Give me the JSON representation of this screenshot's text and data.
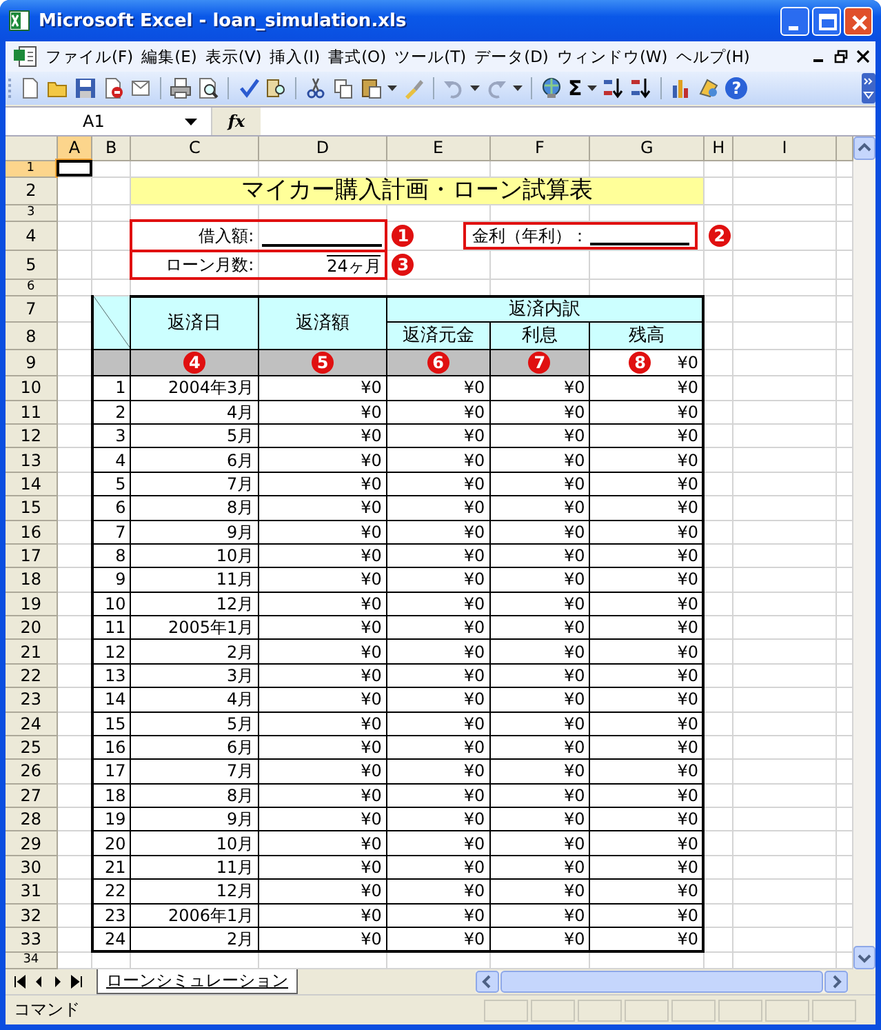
{
  "window": {
    "title": "Microsoft Excel - loan_simulation.xls"
  },
  "menu": [
    {
      "label": "ファイル(F)"
    },
    {
      "label": "編集(E)"
    },
    {
      "label": "表示(V)"
    },
    {
      "label": "挿入(I)"
    },
    {
      "label": "書式(O)"
    },
    {
      "label": "ツール(T)"
    },
    {
      "label": "データ(D)"
    },
    {
      "label": "ウィンドウ(W)"
    },
    {
      "label": "ヘルプ(H)"
    }
  ],
  "toolbar": {
    "autosum": "Σ",
    "help": "?"
  },
  "formula_bar": {
    "name_box": "A1",
    "fx_label": "fx"
  },
  "columns": [
    {
      "label": "A",
      "selected": true
    },
    {
      "label": "B",
      "selected": false
    },
    {
      "label": "C",
      "selected": false
    },
    {
      "label": "D",
      "selected": false
    },
    {
      "label": "E",
      "selected": false
    },
    {
      "label": "F",
      "selected": false
    },
    {
      "label": "G",
      "selected": false
    },
    {
      "label": "H",
      "selected": false
    },
    {
      "label": "I",
      "selected": false
    }
  ],
  "row_headers": [
    {
      "label": "1",
      "selected": true
    },
    {
      "label": "2",
      "selected": false
    },
    {
      "label": "3",
      "selected": false
    },
    {
      "label": "4",
      "selected": false
    },
    {
      "label": "5",
      "selected": false
    },
    {
      "label": "6",
      "selected": false
    },
    {
      "label": "7",
      "selected": false
    },
    {
      "label": "8",
      "selected": false
    },
    {
      "label": "9",
      "selected": false
    },
    {
      "label": "10",
      "selected": false
    },
    {
      "label": "11",
      "selected": false
    },
    {
      "label": "12",
      "selected": false
    },
    {
      "label": "13",
      "selected": false
    },
    {
      "label": "14",
      "selected": false
    },
    {
      "label": "15",
      "selected": false
    },
    {
      "label": "16",
      "selected": false
    },
    {
      "label": "17",
      "selected": false
    },
    {
      "label": "18",
      "selected": false
    },
    {
      "label": "19",
      "selected": false
    },
    {
      "label": "20",
      "selected": false
    },
    {
      "label": "21",
      "selected": false
    },
    {
      "label": "22",
      "selected": false
    },
    {
      "label": "23",
      "selected": false
    },
    {
      "label": "24",
      "selected": false
    },
    {
      "label": "25",
      "selected": false
    },
    {
      "label": "26",
      "selected": false
    },
    {
      "label": "27",
      "selected": false
    },
    {
      "label": "28",
      "selected": false
    },
    {
      "label": "29",
      "selected": false
    },
    {
      "label": "30",
      "selected": false
    },
    {
      "label": "31",
      "selected": false
    },
    {
      "label": "32",
      "selected": false
    },
    {
      "label": "33",
      "selected": false
    },
    {
      "label": "34",
      "selected": false
    }
  ],
  "sheet": {
    "title": "マイカー購入計画・ローン試算表",
    "loan_amount_label": "借入額:",
    "loan_months_label": "ローン月数:",
    "loan_months_value": "24ヶ月",
    "interest_label": "金利（年利）：",
    "callouts": [
      "1",
      "2",
      "3",
      "4",
      "5",
      "6",
      "7",
      "8"
    ],
    "headers": {
      "date": "返済日",
      "payment": "返済額",
      "breakdown": "返済内訳",
      "principal": "返済元金",
      "interest": "利息",
      "balance": "残高"
    },
    "initial_balance": "¥0",
    "rows": [
      {
        "no": "1",
        "date": "2004年3月",
        "payment": "¥0",
        "principal": "¥0",
        "interest": "¥0",
        "balance": "¥0"
      },
      {
        "no": "2",
        "date": "4月",
        "payment": "¥0",
        "principal": "¥0",
        "interest": "¥0",
        "balance": "¥0"
      },
      {
        "no": "3",
        "date": "5月",
        "payment": "¥0",
        "principal": "¥0",
        "interest": "¥0",
        "balance": "¥0"
      },
      {
        "no": "4",
        "date": "6月",
        "payment": "¥0",
        "principal": "¥0",
        "interest": "¥0",
        "balance": "¥0"
      },
      {
        "no": "5",
        "date": "7月",
        "payment": "¥0",
        "principal": "¥0",
        "interest": "¥0",
        "balance": "¥0"
      },
      {
        "no": "6",
        "date": "8月",
        "payment": "¥0",
        "principal": "¥0",
        "interest": "¥0",
        "balance": "¥0"
      },
      {
        "no": "7",
        "date": "9月",
        "payment": "¥0",
        "principal": "¥0",
        "interest": "¥0",
        "balance": "¥0"
      },
      {
        "no": "8",
        "date": "10月",
        "payment": "¥0",
        "principal": "¥0",
        "interest": "¥0",
        "balance": "¥0"
      },
      {
        "no": "9",
        "date": "11月",
        "payment": "¥0",
        "principal": "¥0",
        "interest": "¥0",
        "balance": "¥0"
      },
      {
        "no": "10",
        "date": "12月",
        "payment": "¥0",
        "principal": "¥0",
        "interest": "¥0",
        "balance": "¥0"
      },
      {
        "no": "11",
        "date": "2005年1月",
        "payment": "¥0",
        "principal": "¥0",
        "interest": "¥0",
        "balance": "¥0"
      },
      {
        "no": "12",
        "date": "2月",
        "payment": "¥0",
        "principal": "¥0",
        "interest": "¥0",
        "balance": "¥0"
      },
      {
        "no": "13",
        "date": "3月",
        "payment": "¥0",
        "principal": "¥0",
        "interest": "¥0",
        "balance": "¥0"
      },
      {
        "no": "14",
        "date": "4月",
        "payment": "¥0",
        "principal": "¥0",
        "interest": "¥0",
        "balance": "¥0"
      },
      {
        "no": "15",
        "date": "5月",
        "payment": "¥0",
        "principal": "¥0",
        "interest": "¥0",
        "balance": "¥0"
      },
      {
        "no": "16",
        "date": "6月",
        "payment": "¥0",
        "principal": "¥0",
        "interest": "¥0",
        "balance": "¥0"
      },
      {
        "no": "17",
        "date": "7月",
        "payment": "¥0",
        "principal": "¥0",
        "interest": "¥0",
        "balance": "¥0"
      },
      {
        "no": "18",
        "date": "8月",
        "payment": "¥0",
        "principal": "¥0",
        "interest": "¥0",
        "balance": "¥0"
      },
      {
        "no": "19",
        "date": "9月",
        "payment": "¥0",
        "principal": "¥0",
        "interest": "¥0",
        "balance": "¥0"
      },
      {
        "no": "20",
        "date": "10月",
        "payment": "¥0",
        "principal": "¥0",
        "interest": "¥0",
        "balance": "¥0"
      },
      {
        "no": "21",
        "date": "11月",
        "payment": "¥0",
        "principal": "¥0",
        "interest": "¥0",
        "balance": "¥0"
      },
      {
        "no": "22",
        "date": "12月",
        "payment": "¥0",
        "principal": "¥0",
        "interest": "¥0",
        "balance": "¥0"
      },
      {
        "no": "23",
        "date": "2006年1月",
        "payment": "¥0",
        "principal": "¥0",
        "interest": "¥0",
        "balance": "¥0"
      },
      {
        "no": "24",
        "date": "2月",
        "payment": "¥0",
        "principal": "¥0",
        "interest": "¥0",
        "balance": "¥0"
      }
    ]
  },
  "sheet_tabs": [
    {
      "label": "ローンシミュレーション",
      "selected": true
    }
  ],
  "status_bar": {
    "mode": "コマンド"
  }
}
